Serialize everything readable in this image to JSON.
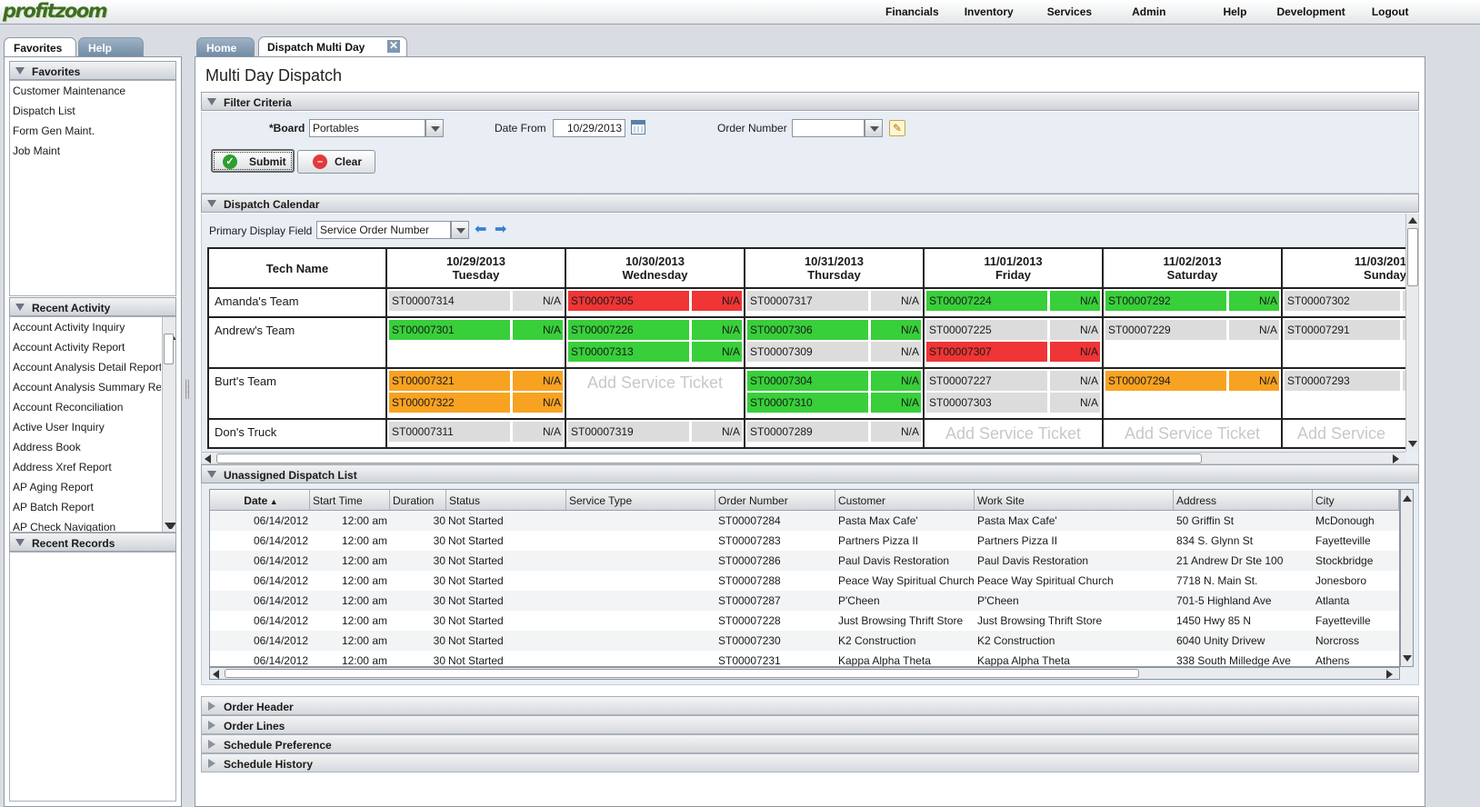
{
  "app": {
    "logo": "profitzoom"
  },
  "topnav": [
    "Financials",
    "Inventory",
    "Services",
    "Admin",
    "Help",
    "Development",
    "Logout"
  ],
  "left_tabs": {
    "favorites": "Favorites",
    "help": "Help"
  },
  "favorites": {
    "title": "Favorites",
    "items": [
      "Customer Maintenance",
      "Dispatch List",
      "Form Gen Maint.",
      "Job Maint"
    ]
  },
  "recent_activity": {
    "title": "Recent Activity",
    "items": [
      "Account Activity Inquiry",
      "Account Activity Report",
      "Account Analysis Detail Report",
      "Account Analysis Summary Report",
      "Account Reconciliation",
      "Active User Inquiry",
      "Address Book",
      "Address Xref Report",
      "AP Aging Report",
      "AP Batch Report",
      "AP Check Navigation"
    ]
  },
  "recent_records": {
    "title": "Recent Records"
  },
  "main_tabs": {
    "home": "Home",
    "dispatch": "Dispatch Multi Day"
  },
  "page_title": "Multi Day Dispatch",
  "filter": {
    "title": "Filter Criteria",
    "board_label": "*Board",
    "board_value": "Portables",
    "date_from_label": "Date From",
    "date_from_value": "10/29/2013",
    "order_number_label": "Order Number",
    "order_number_value": "",
    "submit": "Submit",
    "clear": "Clear"
  },
  "calendar": {
    "title": "Dispatch Calendar",
    "primary_display_label": "Primary Display Field",
    "primary_display_value": "Service Order Number",
    "tech_header": "Tech Name",
    "add_label": "Add Service Ticket",
    "add_label_cut": "Add Service",
    "days": [
      {
        "date": "10/29/2013",
        "day": "Tuesday"
      },
      {
        "date": "10/30/2013",
        "day": "Wednesday"
      },
      {
        "date": "10/31/2013",
        "day": "Thursday"
      },
      {
        "date": "11/01/2013",
        "day": "Friday"
      },
      {
        "date": "11/02/2013",
        "day": "Saturday"
      },
      {
        "date": "11/03/201",
        "day": "Sunday"
      }
    ],
    "na": "N/A",
    "rows": [
      {
        "tech": "Amanda's Team",
        "cells": [
          [
            {
              "id": "ST00007314",
              "color": "gray"
            }
          ],
          [
            {
              "id": "ST00007305",
              "color": "red"
            }
          ],
          [
            {
              "id": "ST00007317",
              "color": "gray"
            }
          ],
          [
            {
              "id": "ST00007224",
              "color": "green"
            }
          ],
          [
            {
              "id": "ST00007292",
              "color": "green"
            }
          ],
          [
            {
              "id": "ST00007302",
              "color": "gray"
            }
          ]
        ]
      },
      {
        "tech": "Andrew's Team",
        "cells": [
          [
            {
              "id": "ST00007301",
              "color": "green"
            }
          ],
          [
            {
              "id": "ST00007226",
              "color": "green"
            },
            {
              "id": "ST00007313",
              "color": "green"
            }
          ],
          [
            {
              "id": "ST00007306",
              "color": "green"
            },
            {
              "id": "ST00007309",
              "color": "gray"
            }
          ],
          [
            {
              "id": "ST00007225",
              "color": "gray"
            },
            {
              "id": "ST00007307",
              "color": "red"
            }
          ],
          [
            {
              "id": "ST00007229",
              "color": "gray"
            }
          ],
          [
            {
              "id": "ST00007291",
              "color": "gray"
            }
          ]
        ]
      },
      {
        "tech": "Burt's Team",
        "cells": [
          [
            {
              "id": "ST00007321",
              "color": "orange"
            },
            {
              "id": "ST00007322",
              "color": "orange"
            }
          ],
          [],
          [
            {
              "id": "ST00007304",
              "color": "green"
            },
            {
              "id": "ST00007310",
              "color": "green"
            }
          ],
          [
            {
              "id": "ST00007227",
              "color": "gray"
            },
            {
              "id": "ST00007303",
              "color": "gray"
            }
          ],
          [
            {
              "id": "ST00007294",
              "color": "orange"
            }
          ],
          [
            {
              "id": "ST00007293",
              "color": "gray"
            }
          ]
        ]
      },
      {
        "tech": "Don's Truck",
        "cells": [
          [
            {
              "id": "ST00007311",
              "color": "gray"
            }
          ],
          [
            {
              "id": "ST00007319",
              "color": "gray"
            }
          ],
          [
            {
              "id": "ST00007289",
              "color": "gray"
            }
          ],
          [],
          [],
          []
        ]
      }
    ]
  },
  "status_colors": {
    "green": "#38cf3a",
    "red": "#ef3535",
    "orange": "#f8a222",
    "gray": "#dcdcdc"
  },
  "unassigned": {
    "title": "Unassigned Dispatch List",
    "columns": [
      "Date",
      "Start Time",
      "Duration",
      "Status",
      "Service Type",
      "Order Number",
      "Customer",
      "Work Site",
      "Address",
      "City"
    ],
    "rows": [
      [
        "06/14/2012",
        "12:00 am",
        "30",
        "Not Started",
        "",
        "ST00007284",
        "Pasta Max Cafe'",
        "Pasta Max Cafe'",
        "50 Griffin St",
        "McDonough"
      ],
      [
        "06/14/2012",
        "12:00 am",
        "30",
        "Not Started",
        "",
        "ST00007283",
        "Partners Pizza II",
        "Partners Pizza II",
        "834 S. Glynn St",
        "Fayetteville"
      ],
      [
        "06/14/2012",
        "12:00 am",
        "30",
        "Not Started",
        "",
        "ST00007286",
        "Paul Davis Restoration",
        "Paul Davis Restoration",
        "21 Andrew Dr Ste 100",
        "Stockbridge"
      ],
      [
        "06/14/2012",
        "12:00 am",
        "30",
        "Not Started",
        "",
        "ST00007288",
        "Peace Way Spiritual Church",
        "Peace Way Spiritual Church",
        "7718 N. Main St.",
        "Jonesboro"
      ],
      [
        "06/14/2012",
        "12:00 am",
        "30",
        "Not Started",
        "",
        "ST00007287",
        "P'Cheen",
        "P'Cheen",
        "701-5 Highland Ave",
        "Atlanta"
      ],
      [
        "06/14/2012",
        "12:00 am",
        "30",
        "Not Started",
        "",
        "ST00007228",
        "Just Browsing Thrift Store",
        "Just Browsing Thrift Store",
        "1450 Hwy 85 N",
        "Fayetteville"
      ],
      [
        "06/14/2012",
        "12:00 am",
        "30",
        "Not Started",
        "",
        "ST00007230",
        "K2 Construction",
        "K2 Construction",
        "6040 Unity Drivew",
        "Norcross"
      ],
      [
        "06/14/2012",
        "12:00 am",
        "30",
        "Not Started",
        "",
        "ST00007231",
        "Kappa Alpha Theta",
        "Kappa Alpha Theta",
        "338 South Milledge Ave",
        "Athens"
      ]
    ]
  },
  "collapsed_sections": [
    "Order Header",
    "Order Lines",
    "Schedule Preference",
    "Schedule History"
  ]
}
